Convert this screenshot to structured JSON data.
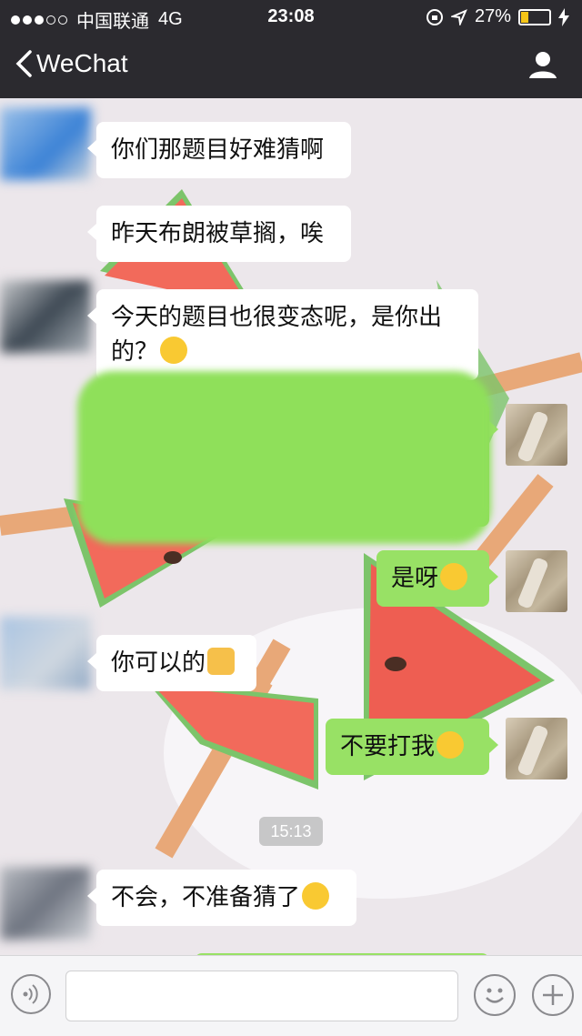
{
  "status_bar": {
    "carrier": "中国联通",
    "network": "4G",
    "time": "23:08",
    "battery": "27%",
    "battery_level": 0.27
  },
  "nav": {
    "back_label": "WeChat"
  },
  "messages": [
    {
      "side": "in",
      "text": "你们那题目好难猜啊",
      "emoji": ""
    },
    {
      "side": "in",
      "text": "昨天布朗被草搁，唉",
      "emoji": ""
    },
    {
      "side": "in",
      "text": "今天的题目也很变态呢，是你出",
      "text2": "的？",
      "emoji": "thinking-face-emoji"
    },
    {
      "side": "out",
      "text": "是呀",
      "emoji": "tears-of-joy-emoji"
    },
    {
      "side": "in",
      "text": "你可以的",
      "emoji": "thumbs-up-emoji"
    },
    {
      "side": "out",
      "text": "不要打我",
      "emoji": "tears-of-joy-emoji"
    },
    {
      "side": "in",
      "text": "不会，不准备猜了",
      "emoji": "thinking-face-emoji"
    }
  ],
  "timestamp": "15:13",
  "colors": {
    "bar_bg": "#2b2a2f",
    "bubble_out": "#98e165",
    "bubble_in": "#ffffff",
    "chat_bg": "#ebe6ea"
  }
}
